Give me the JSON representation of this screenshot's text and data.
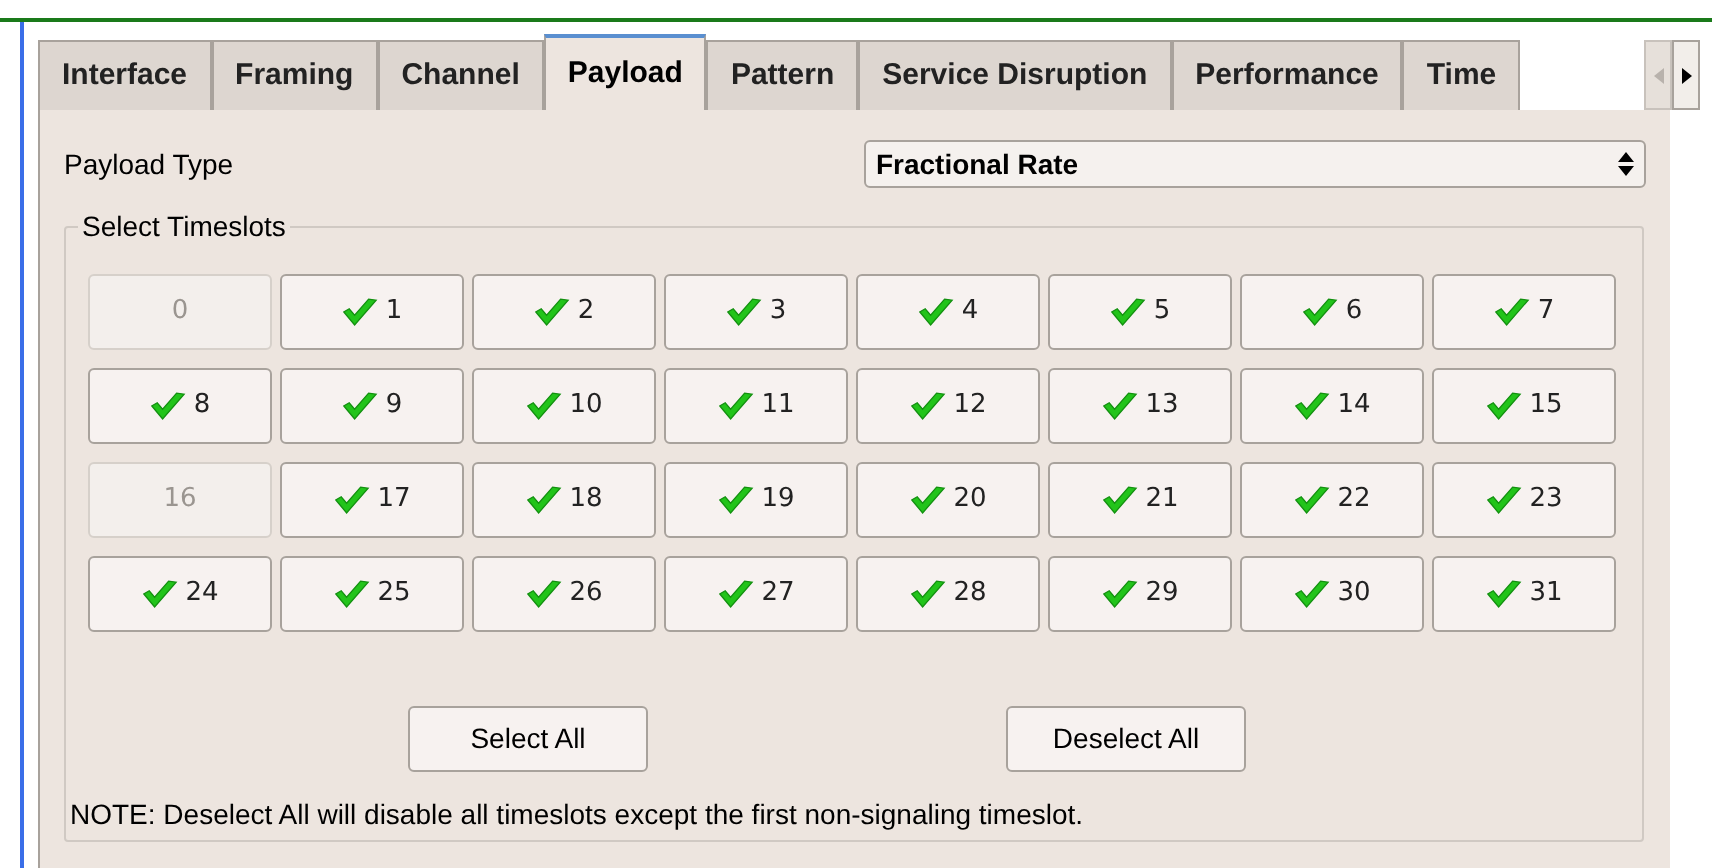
{
  "tabs": [
    {
      "label": "Interface",
      "selected": false
    },
    {
      "label": "Framing",
      "selected": false
    },
    {
      "label": "Channel",
      "selected": false
    },
    {
      "label": "Payload",
      "selected": true
    },
    {
      "label": "Pattern",
      "selected": false
    },
    {
      "label": "Service Disruption",
      "selected": false
    },
    {
      "label": "Performance",
      "selected": false
    },
    {
      "label": "Time",
      "selected": false
    }
  ],
  "payload_type": {
    "label": "Payload Type",
    "value": "Fractional Rate"
  },
  "timeslots": {
    "title": "Select Timeslots",
    "slots": [
      {
        "label": "0",
        "checked": false,
        "disabled": true
      },
      {
        "label": "1",
        "checked": true,
        "disabled": false
      },
      {
        "label": "2",
        "checked": true,
        "disabled": false
      },
      {
        "label": "3",
        "checked": true,
        "disabled": false
      },
      {
        "label": "4",
        "checked": true,
        "disabled": false
      },
      {
        "label": "5",
        "checked": true,
        "disabled": false
      },
      {
        "label": "6",
        "checked": true,
        "disabled": false
      },
      {
        "label": "7",
        "checked": true,
        "disabled": false
      },
      {
        "label": "8",
        "checked": true,
        "disabled": false
      },
      {
        "label": "9",
        "checked": true,
        "disabled": false
      },
      {
        "label": "10",
        "checked": true,
        "disabled": false
      },
      {
        "label": "11",
        "checked": true,
        "disabled": false
      },
      {
        "label": "12",
        "checked": true,
        "disabled": false
      },
      {
        "label": "13",
        "checked": true,
        "disabled": false
      },
      {
        "label": "14",
        "checked": true,
        "disabled": false
      },
      {
        "label": "15",
        "checked": true,
        "disabled": false
      },
      {
        "label": "16",
        "checked": false,
        "disabled": true
      },
      {
        "label": "17",
        "checked": true,
        "disabled": false
      },
      {
        "label": "18",
        "checked": true,
        "disabled": false
      },
      {
        "label": "19",
        "checked": true,
        "disabled": false
      },
      {
        "label": "20",
        "checked": true,
        "disabled": false
      },
      {
        "label": "21",
        "checked": true,
        "disabled": false
      },
      {
        "label": "22",
        "checked": true,
        "disabled": false
      },
      {
        "label": "23",
        "checked": true,
        "disabled": false
      },
      {
        "label": "24",
        "checked": true,
        "disabled": false
      },
      {
        "label": "25",
        "checked": true,
        "disabled": false
      },
      {
        "label": "26",
        "checked": true,
        "disabled": false
      },
      {
        "label": "27",
        "checked": true,
        "disabled": false
      },
      {
        "label": "28",
        "checked": true,
        "disabled": false
      },
      {
        "label": "29",
        "checked": true,
        "disabled": false
      },
      {
        "label": "30",
        "checked": true,
        "disabled": false
      },
      {
        "label": "31",
        "checked": true,
        "disabled": false
      }
    ],
    "buttons": [
      "Select All",
      "Deselect All"
    ]
  },
  "note": "NOTE: Deselect All will disable all timeslots except the first non-signaling timeslot."
}
